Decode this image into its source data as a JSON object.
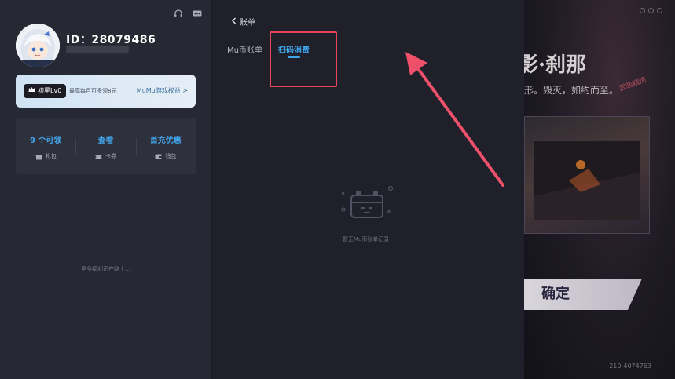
{
  "profile": {
    "id_text": "ID：28079486",
    "vip_badge": "初星Lv0",
    "vip_text": "最高每月可多领8元",
    "vip_link": "MuMu游戏权益 >"
  },
  "stats": [
    {
      "value": "9 个可领",
      "label": "礼包",
      "icon": "gift-icon"
    },
    {
      "value": "查看",
      "label": "卡券",
      "icon": "coupon-icon"
    },
    {
      "value": "首充优惠",
      "label": "钱包",
      "icon": "wallet-icon"
    }
  ],
  "coming_soon": "更多福利正在路上...",
  "bill": {
    "back_label": "账单",
    "tabs": [
      {
        "label": "Mu币账单",
        "active": false
      },
      {
        "label": "扫码消费",
        "active": true
      }
    ],
    "empty_text": "暂无Mu币账单记录~"
  },
  "game": {
    "title": "影·刹那",
    "subtitle": "形。毁灭，如约而至。",
    "tag": "武装精炼",
    "confirm": "确定",
    "code": "210-4074763"
  },
  "colors": {
    "accent": "#3fa6ee",
    "highlight": "#e8455c"
  }
}
